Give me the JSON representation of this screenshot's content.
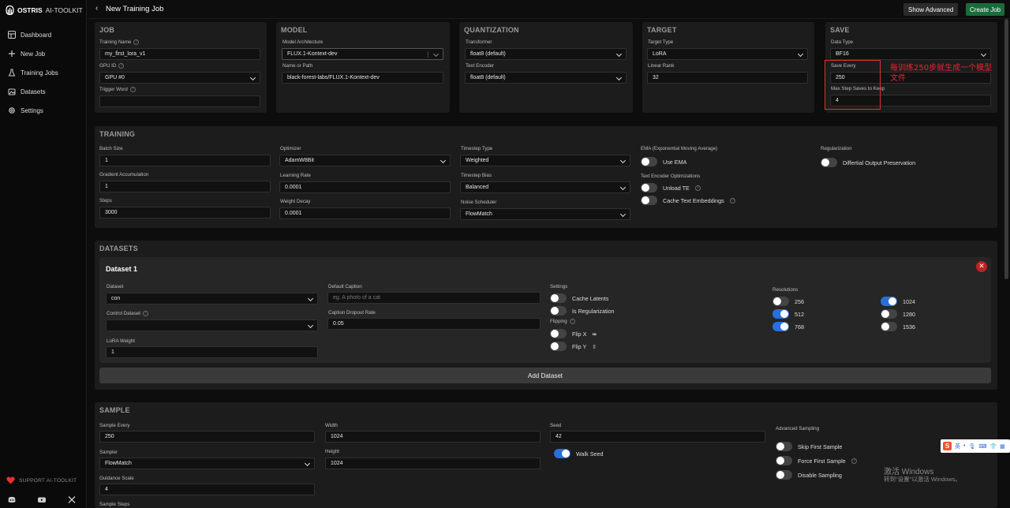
{
  "app": {
    "brand": "OSTRIS",
    "brand_sub": "AI-TOOLKIT"
  },
  "sidebar": {
    "items": [
      {
        "label": "Dashboard",
        "icon": "grid-icon"
      },
      {
        "label": "New Job",
        "icon": "plus-icon"
      },
      {
        "label": "Training Jobs",
        "icon": "flask-icon"
      },
      {
        "label": "Datasets",
        "icon": "image-stack-icon"
      },
      {
        "label": "Settings",
        "icon": "gear-icon"
      }
    ],
    "support": "SUPPORT AI-TOOLKIT"
  },
  "topbar": {
    "back": "‹",
    "title": "New Training Job",
    "show_advanced": "Show Advanced",
    "create_job": "Create Job"
  },
  "job": {
    "title": "JOB",
    "training_name_label": "Training Name",
    "training_name": "my_first_lora_v1",
    "gpu_id_label": "GPU ID",
    "gpu_id": "GPU #0",
    "trigger_word_label": "Trigger Word",
    "trigger_word": ""
  },
  "model": {
    "title": "MODEL",
    "arch_label": "Model Architecture",
    "arch": "FLUX.1-Kontext-dev",
    "path_label": "Name or Path",
    "path": "black-forest-labs/FLUX.1-Kontext-dev"
  },
  "quantization": {
    "title": "QUANTIZATION",
    "transformer_label": "Transformer",
    "transformer": "float8 (default)",
    "text_encoder_label": "Text Encoder",
    "text_encoder": "float8 (default)"
  },
  "target": {
    "title": "TARGET",
    "type_label": "Target Type",
    "type": "LoRA",
    "rank_label": "Linear Rank",
    "rank": "32"
  },
  "save": {
    "title": "SAVE",
    "dtype_label": "Data Type",
    "dtype": "BF16",
    "every_label": "Save Every",
    "every": "250",
    "max_label": "Max Step Saves to Keep",
    "max": "4"
  },
  "annotation": "每训练250步就生成一个模型文件",
  "training": {
    "title": "TRAINING",
    "batch_label": "Batch Size",
    "batch": "1",
    "grad_label": "Gradient Accumulation",
    "grad": "1",
    "steps_label": "Steps",
    "steps": "3000",
    "opt_label": "Optimizer",
    "opt": "AdamW8Bit",
    "lr_label": "Learning Rate",
    "lr": "0.0001",
    "wd_label": "Weight Decay",
    "wd": "0.0001",
    "ts_type_label": "Timestep Type",
    "ts_type": "Weighted",
    "ts_bias_label": "Timestep Bias",
    "ts_bias": "Balanced",
    "sched_label": "Noise Scheduler",
    "sched": "FlowMatch",
    "ema_label": "EMA (Exponential Moving Average)",
    "use_ema": "Use EMA",
    "teo_label": "Text Encoder Optimizations",
    "unload_te": "Unload TE",
    "cache_te": "Cache Text Embeddings",
    "reg_label": "Regularization",
    "dop": "Differtial Output Preservation"
  },
  "datasets": {
    "title": "DATASETS",
    "ds_title": "Dataset 1",
    "dataset_label": "Dataset",
    "dataset": "con",
    "control_label": "Control Dataset",
    "control": "",
    "lora_weight_label": "LoRA Weight",
    "lora_weight": "1",
    "caption_label": "Default Caption",
    "caption_ph": "eg. A photo of a cat",
    "dropout_label": "Caption Dropout Rate",
    "dropout": "0.05",
    "settings_label": "Settings",
    "cache_latents": "Cache Latents",
    "is_reg": "Is Regularization",
    "flipping_label": "Flipping",
    "flip_x": "Flip X",
    "flip_y": "Flip Y",
    "res_label": "Resolutions",
    "res": {
      "r256": "256",
      "r512": "512",
      "r768": "768",
      "r1024": "1024",
      "r1280": "1280",
      "r1536": "1536"
    },
    "add": "Add Dataset"
  },
  "sample": {
    "title": "SAMPLE",
    "every_label": "Sample Every",
    "every": "250",
    "sampler_label": "Sampler",
    "sampler": "FlowMatch",
    "guidance_label": "Guidance Scale",
    "guidance": "4",
    "steps_label": "Sample Steps",
    "width_label": "Width",
    "width": "1024",
    "height_label": "Height",
    "height": "1024",
    "seed_label": "Seed",
    "seed": "42",
    "walk_seed": "Walk Seed",
    "adv_label": "Advanced Sampling",
    "skip_first": "Skip First Sample",
    "force_first": "Force First Sample",
    "disable": "Disable Sampling"
  },
  "ime": {
    "s": "S",
    "lang": "英"
  },
  "watermark": {
    "line1": "激活 Windows",
    "line2": "转到\"设置\"以激活 Windows。"
  }
}
